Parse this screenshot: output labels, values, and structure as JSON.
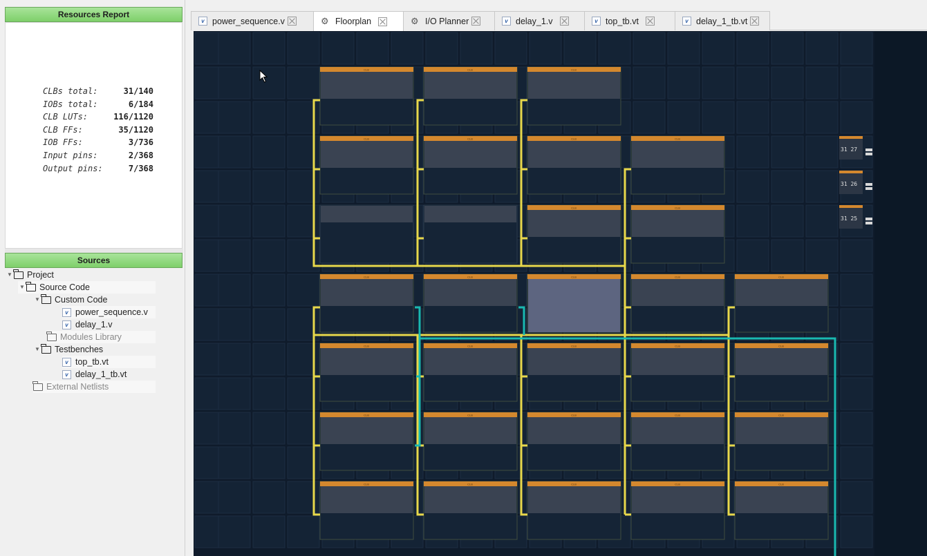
{
  "resources": {
    "title": "Resources Report",
    "stats": [
      {
        "label": "CLBs total:",
        "value": "31/140"
      },
      {
        "label": "IOBs total:",
        "value": "6/184"
      },
      {
        "label": "CLB LUTs:",
        "value": "116/1120"
      },
      {
        "label": "CLB FFs:",
        "value": "35/1120"
      },
      {
        "label": "IOB FFs:",
        "value": "3/736"
      },
      {
        "label": "Input pins:",
        "value": "2/368"
      },
      {
        "label": "Output pins:",
        "value": "7/368"
      }
    ]
  },
  "sources": {
    "title": "Sources",
    "tree": {
      "project": "Project",
      "source_code": "Source Code",
      "custom_code": "Custom Code",
      "file1": "power_sequence.v",
      "file2": "delay_1.v",
      "modules_library": "Modules Library",
      "testbenches": "Testbenches",
      "tb1": "top_tb.vt",
      "tb2": "delay_1_tb.vt",
      "external_netlists": "External Netlists"
    }
  },
  "tabs": [
    {
      "label": "power_sequence.v",
      "icon": "verilog-file-icon"
    },
    {
      "label": "Floorplan",
      "icon": "gear-icon",
      "active": true
    },
    {
      "label": "I/O Planner",
      "icon": "io-gear-icon"
    },
    {
      "label": "delay_1.v",
      "icon": "verilog-file-icon"
    },
    {
      "label": "top_tb.vt",
      "icon": "verilog-file-icon"
    },
    {
      "label": "delay_1_tb.vt",
      "icon": "verilog-file-icon"
    }
  ],
  "floorplan": {
    "block_label": "CLB",
    "io_labels": [
      "31 27",
      "31 26",
      "31 25"
    ],
    "colors": {
      "background": "#0f1b2b",
      "clb_header": "#d4882e",
      "route_primary": "#e8d84a",
      "route_secondary": "#19b8b0",
      "selected": "#5d6580"
    }
  }
}
